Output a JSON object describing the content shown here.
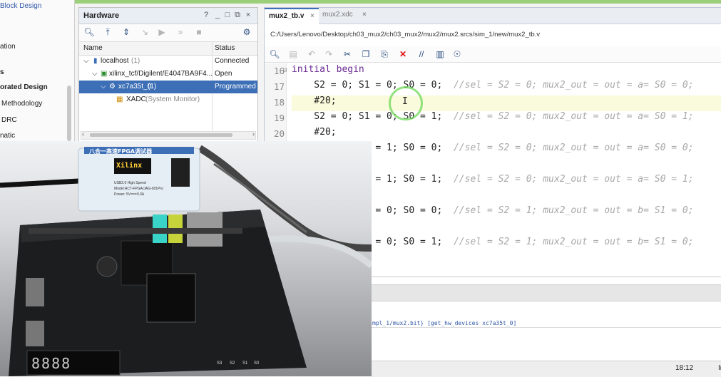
{
  "flow_nav": {
    "items": [
      "Block Design",
      "ation",
      "s",
      "orated Design",
      "Methodology",
      "DRC",
      "natic"
    ]
  },
  "hardware_panel": {
    "title": "Hardware",
    "header_buttons": [
      "?",
      "_",
      "□",
      "⧉",
      "×"
    ],
    "toolbar_icons": [
      "search-icon",
      "collapse-all-icon",
      "expand-all-icon",
      "auto-connect-icon",
      "run-icon",
      "skip-icon",
      "stop-icon",
      "gear-icon"
    ],
    "columns": [
      "Name",
      "Status"
    ],
    "rows": [
      {
        "name": "localhost",
        "count": "(1)",
        "status": "Connected"
      },
      {
        "name": "xilinx_tcf/Digilent/E4047BA9F4...",
        "count": "",
        "status": "Open"
      },
      {
        "name": "xc7a35t_0",
        "count": "(1)",
        "status": "Programmed"
      },
      {
        "name": "XADC",
        "count": "(System Monitor)",
        "status": ""
      }
    ]
  },
  "editor": {
    "tabs": [
      {
        "label": "mux2_tb.v",
        "active": true
      },
      {
        "label": "mux2.xdc",
        "active": false
      }
    ],
    "file_path": "C:/Users/Lenovo/Desktop/ch03_mux2/ch03_mux2/mux2/mux2.srcs/sim_1/new/mux2_tb.v",
    "line_numbers": [
      "16",
      "17",
      "18",
      "19",
      "20"
    ],
    "lines": [
      {
        "code": "initial begin",
        "comment": ""
      },
      {
        "code": "    S2 = 0; S1 = 0; S0 = 0;  ",
        "comment": "//sel = S2 = 0; mux2_out = out = a= S0 = 0;"
      },
      {
        "code": "    #20;",
        "comment": ""
      },
      {
        "code": "    S2 = 0; S1 = 0; S0 = 1;  ",
        "comment": "//sel = S2 = 0; mux2_out = out = a= S0 = 1;"
      },
      {
        "code": "    #20;",
        "comment": ""
      },
      {
        "code": "            S1 = 1; S0 = 0;  ",
        "comment": "//sel = S2 = 0; mux2_out = out = a= S0 = 0;"
      },
      {
        "code": "",
        "comment": ""
      },
      {
        "code": "            S1 = 1; S0 = 1;  ",
        "comment": "//sel = S2 = 0; mux2_out = out = a= S0 = 1;"
      },
      {
        "code": "",
        "comment": ""
      },
      {
        "code": "            S1 = 0; S0 = 0;  ",
        "comment": "//sel = S2 = 1; mux2_out = out = b= S1 = 0;"
      },
      {
        "code": "",
        "comment": ""
      },
      {
        "code": "            S1 = 0; S0 = 1;  ",
        "comment": "//sel = S2 = 1; mux2_out = out = b= S1 = 0;"
      }
    ]
  },
  "console": {
    "line": "mpl_1/mux2.bit} [get_hw_devices xc7a35t_0]"
  },
  "status_bar": {
    "time": "18:12",
    "mode": "In"
  },
  "photo": {
    "programmer_title": "八合一高速FPGA调试器",
    "programmer_brand": "Xilinx",
    "programmer_model": "Model:ACT-FPGA/JAG-001Pro",
    "programmer_usb": "USB2.0 High Speed",
    "programmer_power": "Power: 5V===0.3A",
    "segment_digits": "8888",
    "board_labels": [
      "S3",
      "S2",
      "S1",
      "S0"
    ]
  },
  "colors": {
    "accent": "#3d6fb6",
    "keyword": "#6a2a94",
    "comment": "#a8a8a8",
    "highlight_line": "#fafadc"
  }
}
